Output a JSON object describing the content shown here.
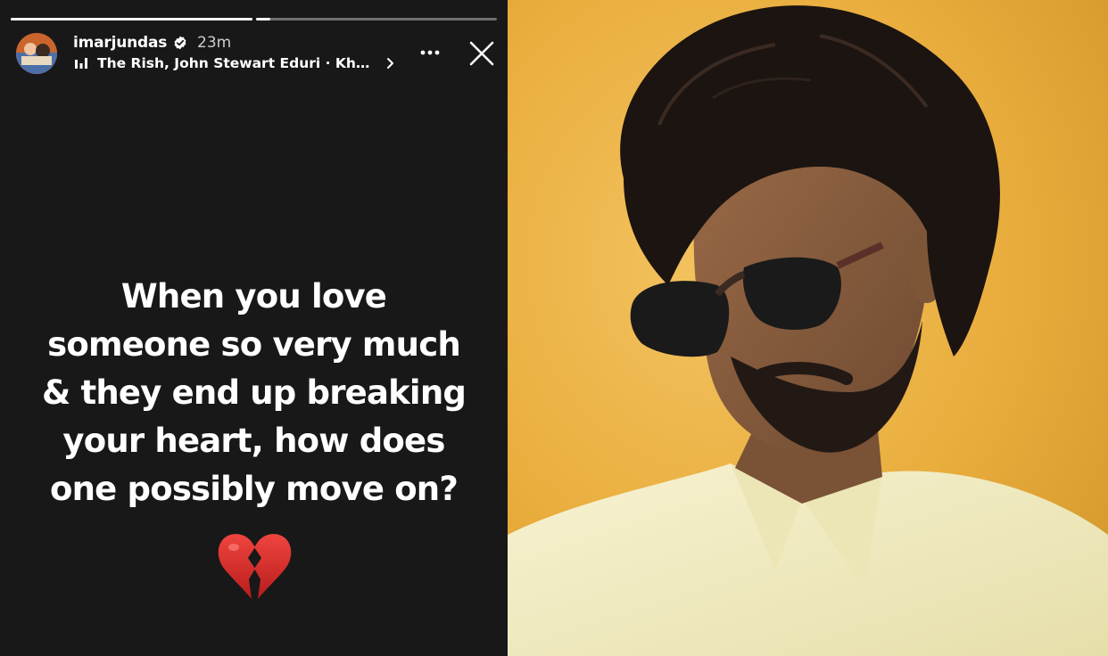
{
  "story": {
    "progress": [
      1.0,
      0.06
    ],
    "username": "imarjundas",
    "timestamp": "23m",
    "music": "The Rish, John Stewart Eduri · Khus…",
    "text_lines": [
      "When you love",
      "someone so very much",
      "& they end up breaking",
      "your heart, how does",
      "one possibly move on?"
    ],
    "emoji": "broken-heart"
  },
  "colors": {
    "story_bg": "#181818",
    "text": "#ffffff",
    "heart_red": "#d32f2f",
    "photo_bg": "#e9ad3d",
    "shirt": "#f3eec4"
  }
}
